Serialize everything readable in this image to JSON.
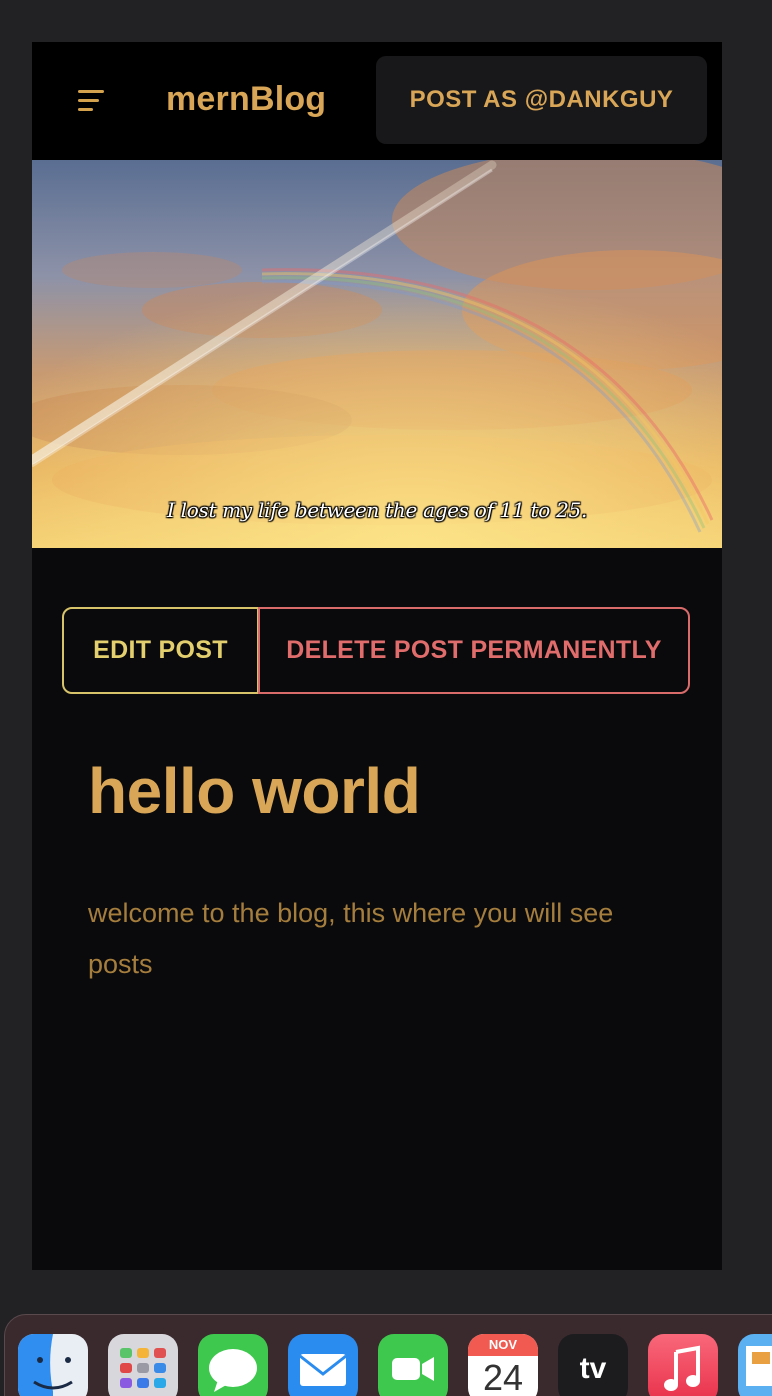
{
  "navbar": {
    "menu_icon": "hamburger-menu-icon",
    "brand": "mernBlog",
    "post_as_label": "POST AS @DANKGUY"
  },
  "hero": {
    "caption": "I lost my life between the ages of 11 to 25."
  },
  "actions": {
    "edit_label": "EDIT POST",
    "delete_label": "DELETE POST PERMANENTLY"
  },
  "post": {
    "title": "hello world",
    "body": "welcome to the blog, this where you will see posts"
  },
  "dock": {
    "apps": [
      {
        "name": "Finder",
        "icon": "finder-icon"
      },
      {
        "name": "Launchpad",
        "icon": "launchpad-icon"
      },
      {
        "name": "Messages",
        "icon": "messages-icon"
      },
      {
        "name": "Mail",
        "icon": "mail-icon"
      },
      {
        "name": "FaceTime",
        "icon": "facetime-icon"
      },
      {
        "name": "Calendar",
        "icon": "calendar-icon",
        "month": "NOV",
        "day": "24"
      },
      {
        "name": "TV",
        "icon": "apple-tv-icon",
        "label": "tv"
      },
      {
        "name": "Music",
        "icon": "music-icon"
      },
      {
        "name": "Preview",
        "icon": "preview-icon"
      }
    ]
  },
  "colors": {
    "accent": "#d8a656",
    "edit": "#d7c36a",
    "delete": "#d96b6b",
    "background": "#0a0a0c"
  }
}
